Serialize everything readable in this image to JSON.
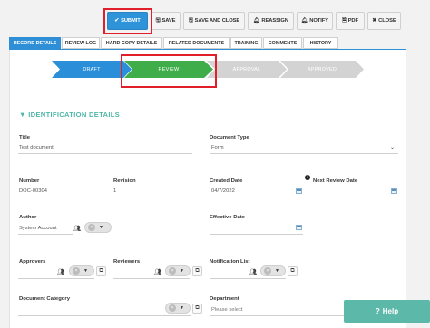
{
  "toolbar": {
    "submit": "SUBMIT",
    "save": "SAVE",
    "save_close": "SAVE AND CLOSE",
    "reassign": "REASSIGN",
    "notify": "NOTIFY",
    "pdf": "PDF",
    "close": "CLOSE"
  },
  "tabs": [
    "RECORD DETAILS",
    "REVIEW LOG",
    "HARD COPY DETAILS",
    "RELATED DOCUMENTS",
    "TRAINING",
    "COMMENTS",
    "HISTORY"
  ],
  "active_tab": "RECORD DETAILS",
  "workflow": {
    "steps": [
      "DRAFT",
      "REVIEW",
      "APPROVAL",
      "APPROVED"
    ],
    "current": "REVIEW"
  },
  "colors": {
    "accent": "#2f8fd6",
    "draft": "#2a8fd8",
    "review": "#3fae4a",
    "pending": "#d3d3d3",
    "section": "#4fb7a8",
    "highlight": "#e01f2a",
    "help": "#5cb8a8"
  },
  "section": {
    "title": "IDENTIFICATION DETAILS"
  },
  "fields": {
    "title_label": "Title",
    "title_value": "Test document",
    "doc_type_label": "Document Type",
    "doc_type_value": "Form",
    "number_label": "Number",
    "number_value": "DOC-00304",
    "revision_label": "Revision",
    "revision_value": "1",
    "created_date_label": "Created Date",
    "created_date_value": "04/7/2022",
    "next_review_label": "Next Review Date",
    "author_label": "Author",
    "author_value": "System Account",
    "effective_date_label": "Effective Date",
    "approvers_label": "Approvers",
    "reviewers_label": "Reviewers",
    "notification_list_label": "Notification List",
    "doc_category_label": "Document Category",
    "department_label": "Department",
    "department_placeholder": "Please select"
  },
  "help": {
    "label": "Help"
  }
}
